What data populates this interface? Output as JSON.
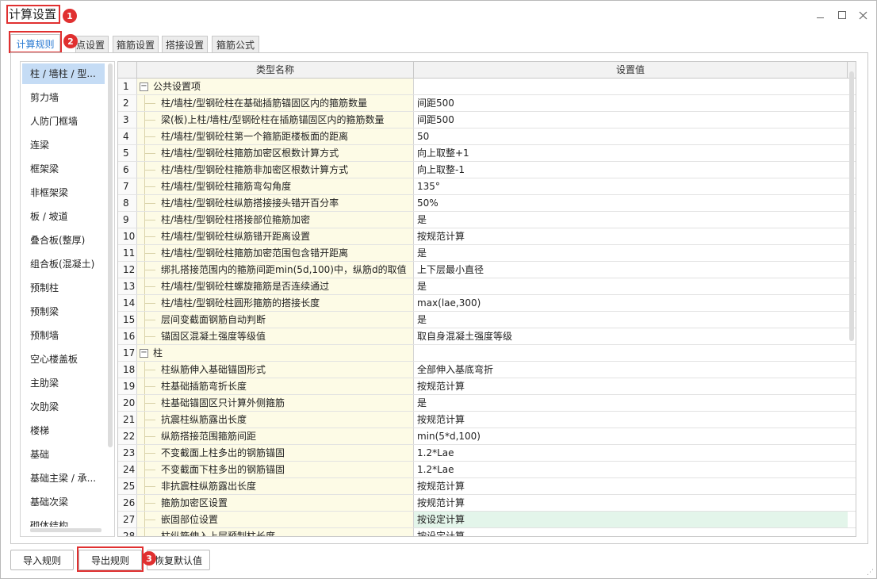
{
  "window": {
    "title": "计算设置",
    "minimize_icon": "minimize-icon",
    "maximize_icon": "maximize-icon",
    "close_icon": "close-icon"
  },
  "annotations": [
    "1",
    "2",
    "3"
  ],
  "accent_colors": {
    "annotation_red": "#e03030",
    "tab_active_blue": "#2a7ad2",
    "sidebar_selected": "#c5dcf5",
    "name_cell_bg": "#fdfbe6",
    "highlight_row": "#e3f5ea"
  },
  "tabs": [
    {
      "label": "计算规则",
      "active": true
    },
    {
      "label": "节点设置",
      "active": false
    },
    {
      "label": "箍筋设置",
      "active": false
    },
    {
      "label": "搭接设置",
      "active": false
    },
    {
      "label": "箍筋公式",
      "active": false
    }
  ],
  "sidebar": {
    "items": [
      {
        "label": "柱 / 墙柱 / 型...",
        "selected": true
      },
      {
        "label": "剪力墙"
      },
      {
        "label": "人防门框墙"
      },
      {
        "label": "连梁"
      },
      {
        "label": "框架梁"
      },
      {
        "label": "非框架梁"
      },
      {
        "label": "板 / 坡道"
      },
      {
        "label": "叠合板(整厚)"
      },
      {
        "label": "组合板(混凝土)"
      },
      {
        "label": "预制柱"
      },
      {
        "label": "预制梁"
      },
      {
        "label": "预制墙"
      },
      {
        "label": "空心楼盖板"
      },
      {
        "label": "主肋梁"
      },
      {
        "label": "次肋梁"
      },
      {
        "label": "楼梯"
      },
      {
        "label": "基础"
      },
      {
        "label": "基础主梁 / 承..."
      },
      {
        "label": "基础次梁"
      },
      {
        "label": "砌体结构"
      }
    ]
  },
  "grid": {
    "headers": {
      "name": "类型名称",
      "value": "设置值"
    },
    "rows": [
      {
        "num": "1",
        "name": "公共设置项",
        "value": "",
        "group": true,
        "expander": "−"
      },
      {
        "num": "2",
        "name": "柱/墙柱/型钢砼柱在基础插筋锚固区内的箍筋数量",
        "value": "间距500"
      },
      {
        "num": "3",
        "name": "梁(板)上柱/墙柱/型钢砼柱在插筋锚固区内的箍筋数量",
        "value": "间距500"
      },
      {
        "num": "4",
        "name": "柱/墙柱/型钢砼柱第一个箍筋距楼板面的距离",
        "value": "50"
      },
      {
        "num": "5",
        "name": "柱/墙柱/型钢砼柱箍筋加密区根数计算方式",
        "value": "向上取整+1"
      },
      {
        "num": "6",
        "name": "柱/墙柱/型钢砼柱箍筋非加密区根数计算方式",
        "value": "向上取整-1"
      },
      {
        "num": "7",
        "name": "柱/墙柱/型钢砼柱箍筋弯勾角度",
        "value": "135°"
      },
      {
        "num": "8",
        "name": "柱/墙柱/型钢砼柱纵筋搭接接头错开百分率",
        "value": "50%"
      },
      {
        "num": "9",
        "name": "柱/墙柱/型钢砼柱搭接部位箍筋加密",
        "value": "是"
      },
      {
        "num": "10",
        "name": "柱/墙柱/型钢砼柱纵筋错开距离设置",
        "value": "按规范计算"
      },
      {
        "num": "11",
        "name": "柱/墙柱/型钢砼柱箍筋加密范围包含错开距离",
        "value": "是"
      },
      {
        "num": "12",
        "name": "绑扎搭接范围内的箍筋间距min(5d,100)中，纵筋d的取值",
        "value": "上下层最小直径"
      },
      {
        "num": "13",
        "name": "柱/墙柱/型钢砼柱螺旋箍筋是否连续通过",
        "value": "是"
      },
      {
        "num": "14",
        "name": "柱/墙柱/型钢砼柱圆形箍筋的搭接长度",
        "value": "max(lae,300)"
      },
      {
        "num": "15",
        "name": "层间变截面钢筋自动判断",
        "value": "是"
      },
      {
        "num": "16",
        "name": "锚固区混凝土强度等级值",
        "value": "取自身混凝土强度等级"
      },
      {
        "num": "17",
        "name": "柱",
        "value": "",
        "group": true,
        "expander": "−"
      },
      {
        "num": "18",
        "name": "柱纵筋伸入基础锚固形式",
        "value": "全部伸入基底弯折"
      },
      {
        "num": "19",
        "name": "柱基础插筋弯折长度",
        "value": "按规范计算"
      },
      {
        "num": "20",
        "name": "柱基础锚固区只计算外侧箍筋",
        "value": "是"
      },
      {
        "num": "21",
        "name": "抗震柱纵筋露出长度",
        "value": "按规范计算"
      },
      {
        "num": "22",
        "name": "纵筋搭接范围箍筋间距",
        "value": "min(5*d,100)"
      },
      {
        "num": "23",
        "name": "不变截面上柱多出的钢筋锚固",
        "value": "1.2*Lae"
      },
      {
        "num": "24",
        "name": "不变截面下柱多出的钢筋锚固",
        "value": "1.2*Lae"
      },
      {
        "num": "25",
        "name": "非抗震柱纵筋露出长度",
        "value": "按规范计算"
      },
      {
        "num": "26",
        "name": "箍筋加密区设置",
        "value": "按规范计算"
      },
      {
        "num": "27",
        "name": "嵌固部位设置",
        "value": "按设定计算",
        "highlight": true
      },
      {
        "num": "28",
        "name": "柱纵筋伸入上层预制柱长度",
        "value": "按设定计算"
      }
    ]
  },
  "buttons": {
    "import": "导入规则",
    "export": "导出规则",
    "reset": "恢复默认值"
  }
}
